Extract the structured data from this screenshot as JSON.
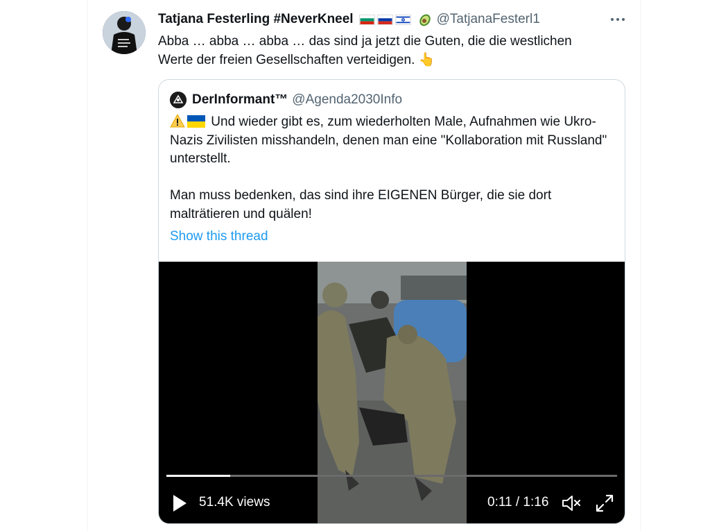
{
  "tweet": {
    "author_name": "Tatjana Festerling #NeverKneel",
    "flags": [
      "bulgaria-flag",
      "russia-flag",
      "israel-flag",
      "avocado-emoji"
    ],
    "handle": "@TatjanaFesterl1",
    "text": "Abba … abba … abba … das sind ja jetzt die Guten, die die westlichen Werte der freien Gesellschaften verteidigen. 👆"
  },
  "quote": {
    "author_name": "DerInformant™",
    "handle": "@Agenda2030Info",
    "icons": [
      "warning-emoji",
      "ukraine-flag"
    ],
    "paragraph1": "Und wieder gibt es, zum wiederholten Male, Aufnahmen wie Ukro-Nazis Zivilisten misshandeln, denen man eine \"Kollaboration mit Russland\" unterstellt.",
    "paragraph2": "Man muss bedenken, das sind ihre EIGENEN Bürger, die sie dort malträtieren und quälen!",
    "show_thread": "Show this thread"
  },
  "video": {
    "views": "51.4K views",
    "time": "0:11 / 1:16",
    "progress": 0.142
  },
  "colors": {
    "link": "#1d9bf0",
    "secondary_text": "#536471",
    "border": "#cfd9de"
  }
}
